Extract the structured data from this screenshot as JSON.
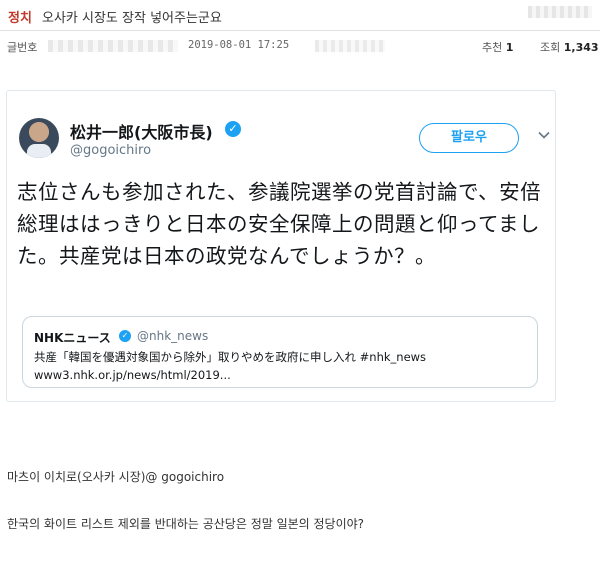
{
  "header": {
    "category": "정치",
    "title": "오사카 시장도 장작 넣어주는군요"
  },
  "meta": {
    "label_no": "글번호",
    "datetime": "2019-08-01 17:25",
    "rec_label": "추천",
    "rec_count": "1",
    "views_label": "조회",
    "views_count": "1,343"
  },
  "tweet": {
    "display_name": "松井一郎(大阪市長)",
    "handle": "@gogoichiro",
    "follow_label": "팔로우",
    "body": "志位さんも参加された、参議院選挙の党首討論で、安倍総理ははっきりと日本の安全保障上の問題と仰ってました。共産党は日本の政党なんでしょうか？。",
    "quote": {
      "name": "NHKニュース",
      "handle": "@nhk_news",
      "text": "共産「韓国を優遇対象国から除外」取りやめを政府に申し入れ #nhk_news",
      "link": "www3.nhk.or.jp/news/html/2019..."
    }
  },
  "post": {
    "caption": "마츠이 이치로(오사카 시장)@ gogoichiro",
    "comment": "한국의 화이트 리스트 제외를 반대하는 공산당은 정말 일본의 정당이야?"
  },
  "colors": {
    "category": "#c0392b",
    "twitter_blue": "#1da1f2"
  },
  "icons": [
    "verified-icon",
    "chevron-down-icon"
  ]
}
